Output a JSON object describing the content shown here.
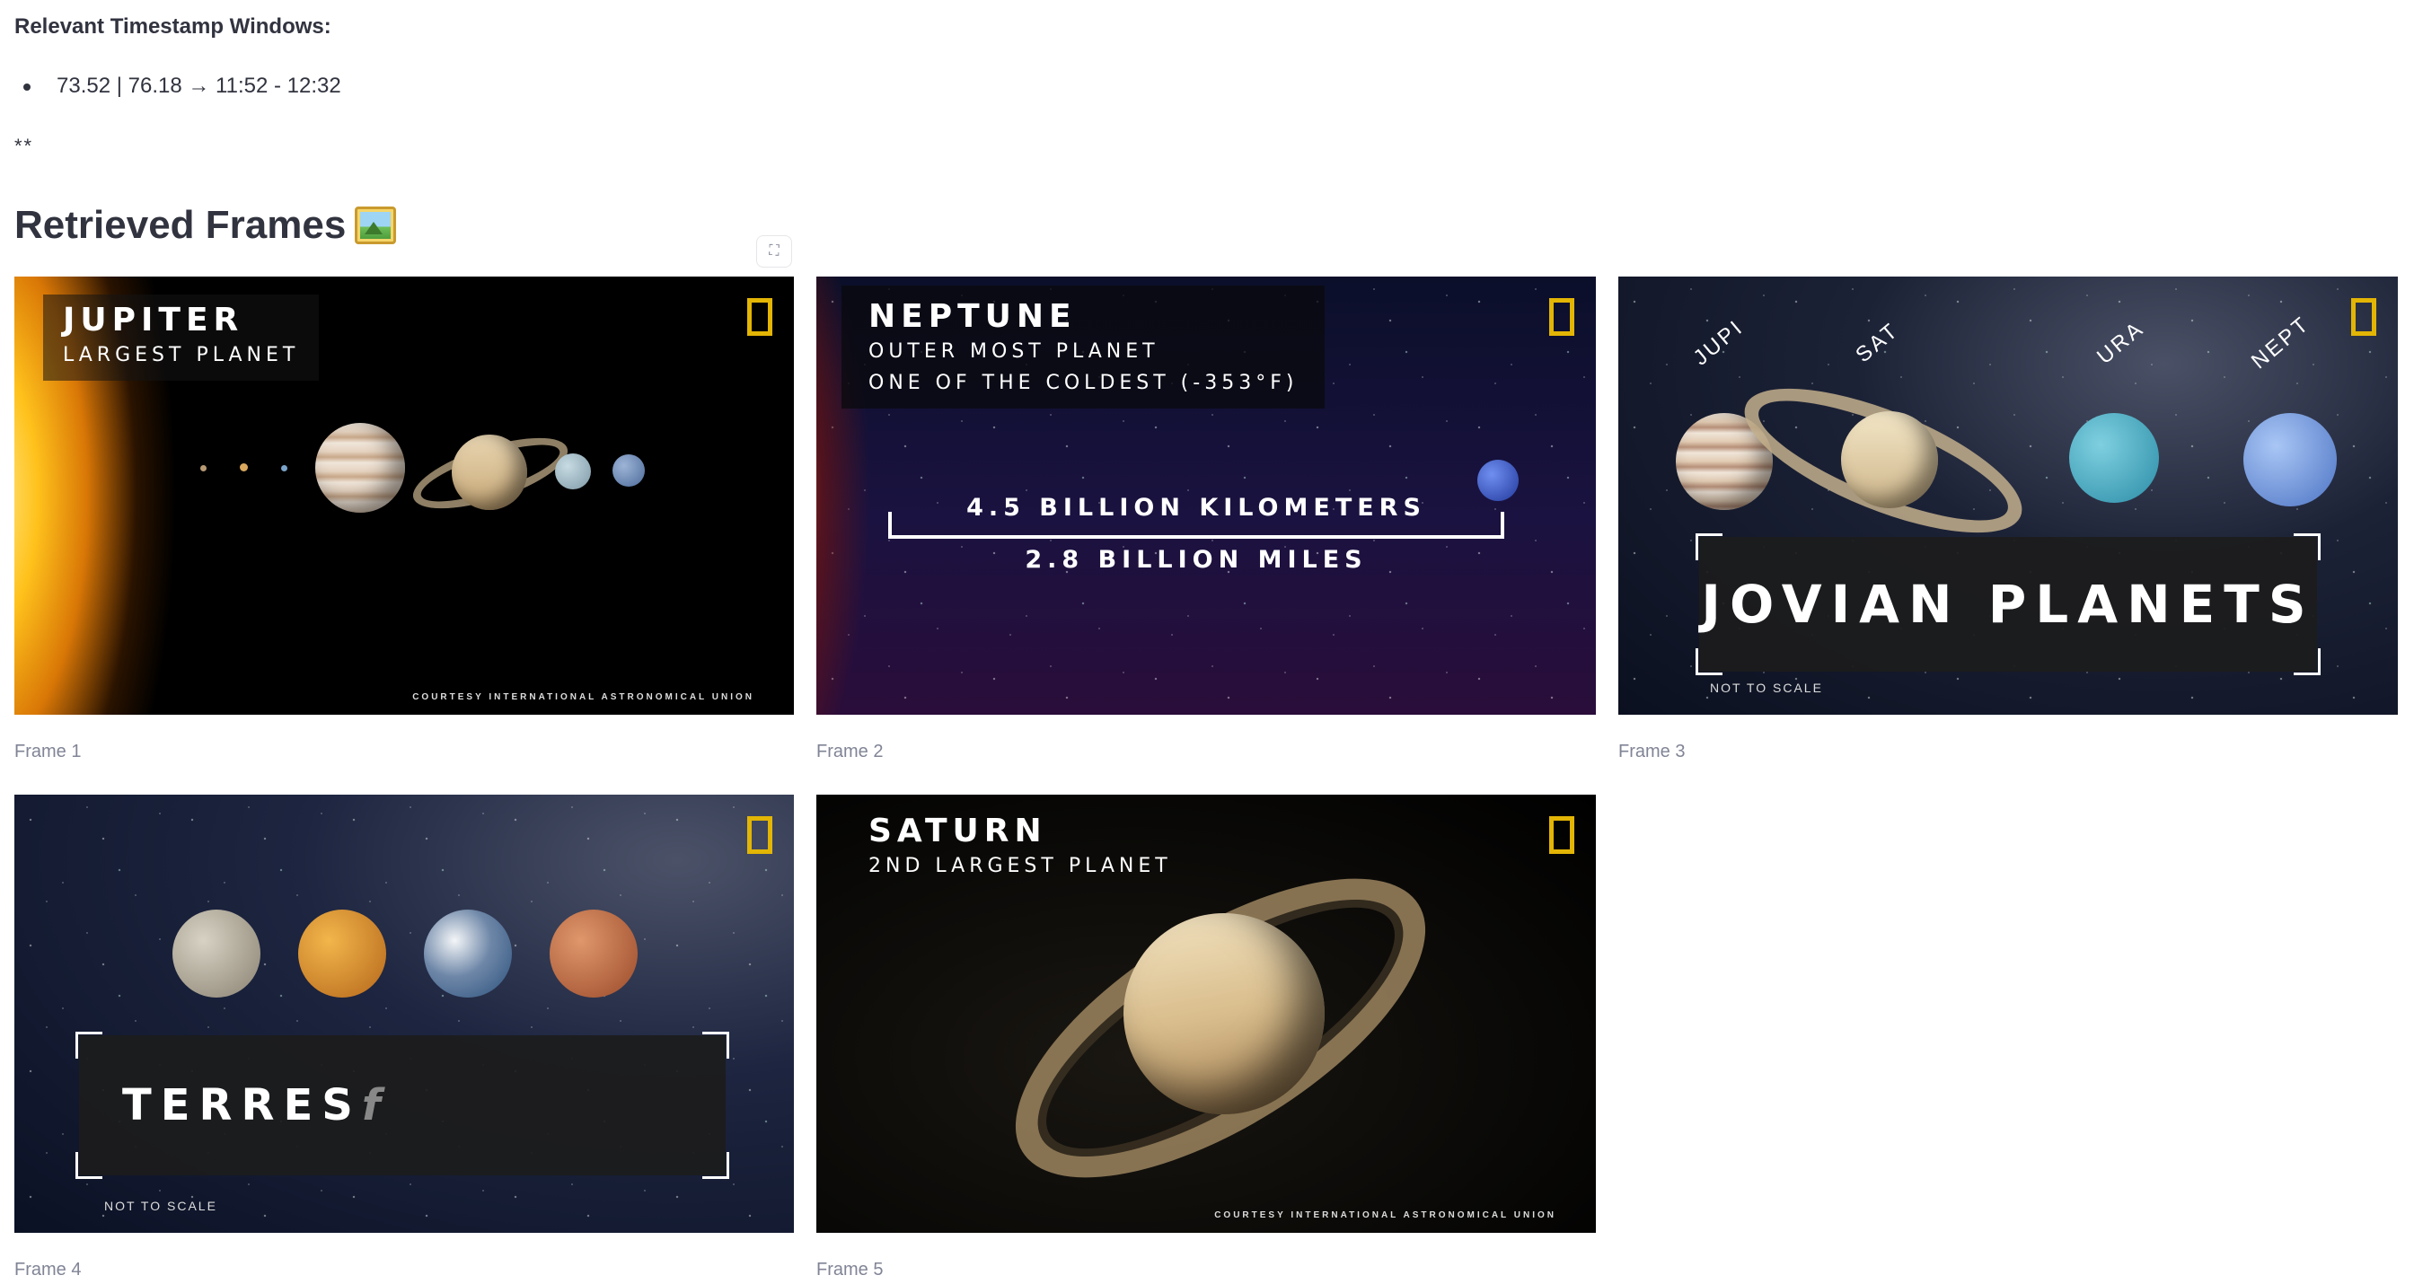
{
  "timestamps": {
    "heading": "Relevant Timestamp Windows:",
    "items": [
      "73.52 | 76.18 → 11:52 - 12:32"
    ],
    "trailing": "**"
  },
  "section": {
    "title": "Retrieved Frames",
    "icon": "framed-picture-icon",
    "fullscreen_icon": "⛶"
  },
  "frames": [
    {
      "caption": "Frame 1",
      "title": "JUPITER",
      "subtitle": "LARGEST PLANET",
      "courtesy": "COURTESY INTERNATIONAL ASTRONOMICAL UNION"
    },
    {
      "caption": "Frame 2",
      "title": "NEPTUNE",
      "subtitle": "OUTER MOST PLANET",
      "subtitle2": "ONE OF THE COLDEST (-353°F)",
      "distance_km": "4.5 BILLION KILOMETERS",
      "distance_mi": "2.8 BILLION MILES"
    },
    {
      "caption": "Frame 3",
      "banner": "JOVIAN PLANETS",
      "note": "NOT TO SCALE",
      "labels": [
        "JUPI",
        "SAT",
        "URA",
        "NEPT"
      ]
    },
    {
      "caption": "Frame 4",
      "banner": "TERRES",
      "banner_fade": "f",
      "note": "NOT TO SCALE"
    },
    {
      "caption": "Frame 5",
      "title": "SATURN",
      "subtitle": "2ND LARGEST PLANET",
      "courtesy": "COURTESY INTERNATIONAL ASTRONOMICAL UNION"
    }
  ],
  "colors": {
    "text": "#31333f",
    "caption": "#808495",
    "nat_geo_yellow": "#e3b505"
  }
}
